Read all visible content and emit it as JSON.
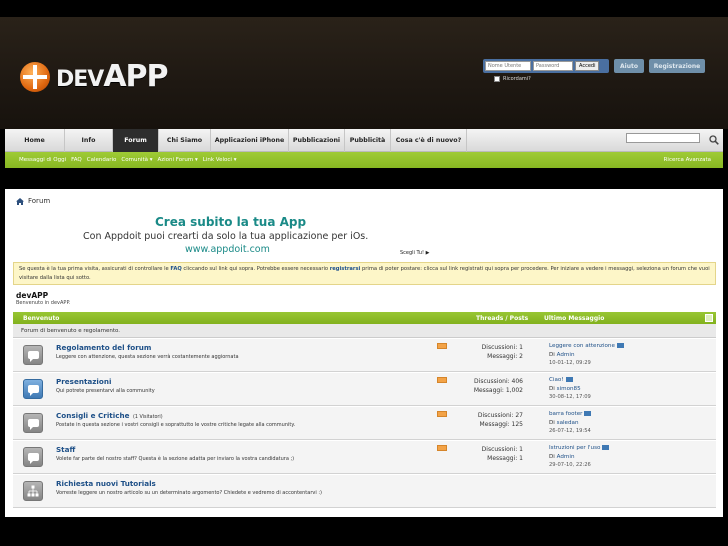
{
  "header": {
    "logo_text_small": "DEV",
    "logo_text_big": "APP",
    "login": {
      "username_placeholder": "Nome Utente",
      "password_placeholder": "Password",
      "submit_label": "Accedi",
      "remember_label": "Ricordami?"
    },
    "help_label": "Aiuto",
    "register_label": "Registrazione"
  },
  "nav": {
    "tabs": [
      {
        "label": "Home"
      },
      {
        "label": "Info"
      },
      {
        "label": "Forum"
      },
      {
        "label": "Chi Siamo"
      },
      {
        "label": "Applicazioni iPhone"
      },
      {
        "label": "Pubblicazioni"
      },
      {
        "label": "Pubblicità"
      },
      {
        "label": "Cosa c'è di nuovo?"
      }
    ],
    "active_tab": "Forum"
  },
  "subnav": {
    "items": [
      "Messaggi di Oggi",
      "FAQ",
      "Calendario",
      "Comunità ▾",
      "Azioni Forum ▾",
      "Link Veloci ▾"
    ],
    "advanced_search": "Ricerca Avanzata"
  },
  "breadcrumb": "Forum",
  "ad": {
    "title": "Crea subito la tua App",
    "subtitle": "Con Appdoit puoi crearti da solo la tua applicazione per iOs.",
    "link": "www.appdoit.com",
    "tip": "Scegli Tu! ▶"
  },
  "notice": {
    "text_1": "Se questa è la tua prima visita, assicurati di controllare le ",
    "faq": "FAQ",
    "text_2": " cliccando sul link qui sopra. Potrebbe essere necessario ",
    "registrarsi": "registrarsi",
    "text_3": " prima di poter postare: clicca sul link registrati qui sopra per procedere. Per iniziare a vedere i messaggi, seleziona un forum che vuoi visitare dalla lista qui sotto."
  },
  "forum_section": {
    "title": "devAPP",
    "subtitle": "Benvenuto in devAPP."
  },
  "category": {
    "name": "Benvenuto",
    "col_threads": "Threads / Posts",
    "col_last": "Ultimo Messaggio",
    "description": "Forum di benvenuto e regolamento."
  },
  "forums": [
    {
      "name": "Regolamento del forum",
      "viewers": "",
      "desc": "Leggere con attenzione, questa sezione verrà costantemente aggiornata",
      "threads": "Discussioni: 1",
      "posts": "Messaggi: 2",
      "last_title": "Leggere con attenzione",
      "last_by": "Di",
      "last_user": "Admin",
      "last_when": "10-01-12, 09:29",
      "icon_style": "gray"
    },
    {
      "name": "Presentazioni",
      "viewers": "",
      "desc": "Qui potrete presentarvi alla community",
      "threads": "Discussioni: 406",
      "posts": "Messaggi: 1,002",
      "last_title": "Ciao!",
      "last_by": "Di",
      "last_user": "simon85",
      "last_when": "30-08-12, 17:09",
      "icon_style": "blue"
    },
    {
      "name": "Consigli e Critiche",
      "viewers": "(1 Visitatori)",
      "desc": "Postate in questa sezione i vostri consigli e soprattutto le vostre critiche legate alla community.",
      "threads": "Discussioni: 27",
      "posts": "Messaggi: 125",
      "last_title": "barra footer",
      "last_by": "Di",
      "last_user": "saledan",
      "last_when": "26-07-12, 19:54",
      "icon_style": "gray"
    },
    {
      "name": "Staff",
      "viewers": "",
      "desc": "Volete far parte del nostro staff? Questa è la sezione adatta per inviaro la vostra candidatura ;)",
      "threads": "Discussioni: 1",
      "posts": "Messaggi: 1",
      "last_title": "Istruzioni per l'uso",
      "last_by": "Di",
      "last_user": "Admin",
      "last_when": "29-07-10, 22:26",
      "icon_style": "gray"
    },
    {
      "name": "Richiesta nuovi Tutorials",
      "viewers": "",
      "desc": "Vorreste leggere un nostro articolo su un determinato argomento? Chiedete e vedremo di accontentarvi :)",
      "threads": "",
      "posts": "",
      "last_title": "",
      "last_by": "",
      "last_user": "",
      "last_when": "",
      "icon_style": "gray"
    }
  ],
  "colors": {
    "header_bg": "#1e1812",
    "accent_green": "#8bbb25",
    "link_blue": "#1d4f87",
    "ad_teal": "#1a8a87",
    "notice_bg": "#fdf6c8"
  }
}
